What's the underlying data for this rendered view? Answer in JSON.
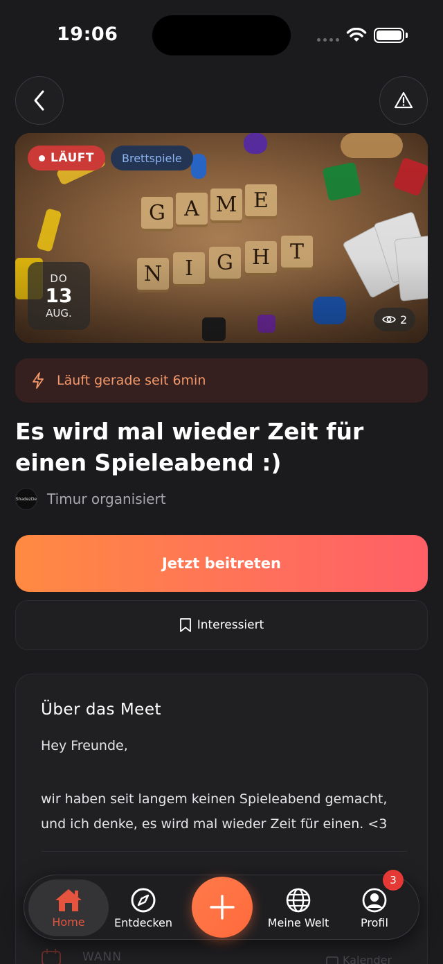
{
  "status_bar": {
    "time": "19:06"
  },
  "event": {
    "status_badge": "LÄUFT",
    "category": "Brettspiele",
    "date": {
      "weekday": "DO",
      "day": "13",
      "month": "AUG."
    },
    "views": "2",
    "live_banner": "Läuft gerade seit 6min",
    "title": "Es wird mal wieder Zeit für einen Spieleabend :)",
    "organizer": {
      "avatar_text": "ShadezDe",
      "label": "Timur organisiert"
    },
    "hero_tiles_row1": [
      "G",
      "A",
      "M",
      "E"
    ],
    "hero_tiles_row2": [
      "N",
      "I",
      "G",
      "H",
      "T"
    ]
  },
  "actions": {
    "join_label": "Jetzt beitreten",
    "interest_label": "Interessiert"
  },
  "about": {
    "title": "Über das Meet",
    "greeting": "Hey Freunde,",
    "body": "wir haben seit langem keinen Spieleabend gemacht, und ich denke, es wird mal wieder Zeit für einen. <3",
    "wann_label": "WANN",
    "calendar_label": "Kalender"
  },
  "bottom_nav": {
    "items": [
      {
        "label": "Home",
        "icon": "home-icon",
        "active": true
      },
      {
        "label": "Entdecken",
        "icon": "compass-icon"
      },
      {
        "label": "Meine Welt",
        "icon": "globe-icon"
      },
      {
        "label": "Profil",
        "icon": "user-icon"
      }
    ],
    "profile_badge": "3"
  },
  "colors": {
    "accent": "#ff6a3c",
    "live_red": "#cc3a38",
    "background": "#1b1b1e"
  }
}
